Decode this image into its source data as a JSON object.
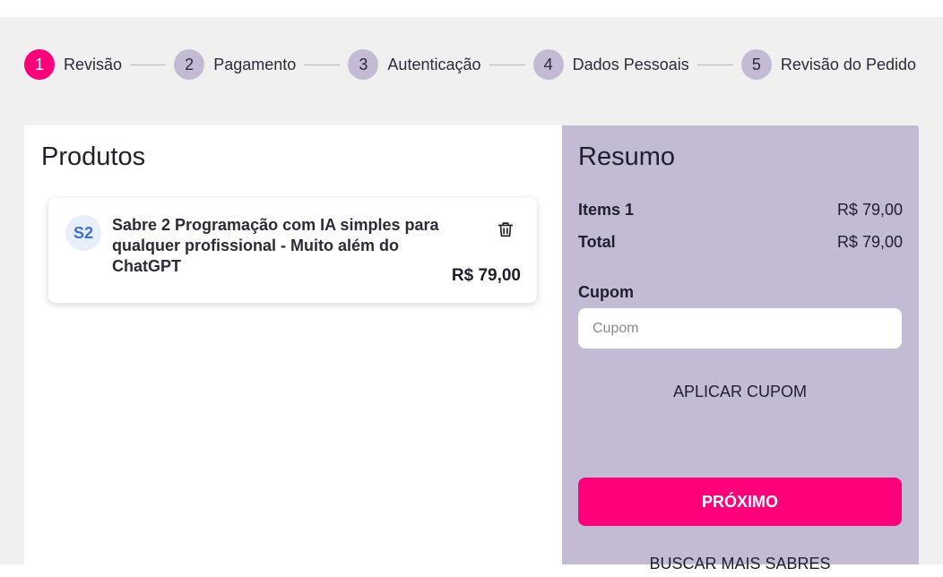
{
  "stepper": {
    "steps": [
      {
        "number": "1",
        "label": "Revisão",
        "active": true
      },
      {
        "number": "2",
        "label": "Pagamento",
        "active": false
      },
      {
        "number": "3",
        "label": "Autenticação",
        "active": false
      },
      {
        "number": "4",
        "label": "Dados Pessoais",
        "active": false
      },
      {
        "number": "5",
        "label": "Revisão do Pedido",
        "active": false
      }
    ]
  },
  "products": {
    "title": "Produtos",
    "items": [
      {
        "avatar": "S2",
        "name": "Sabre 2 Programação com IA simples para qualquer profissional - Muito além do ChatGPT",
        "price": "R$ 79,00",
        "delete_icon": "trash-icon"
      }
    ]
  },
  "summary": {
    "title": "Resumo",
    "items_label": "Items 1",
    "items_value": "R$ 79,00",
    "total_label": "Total",
    "total_value": "R$ 79,00",
    "coupon_label": "Cupom",
    "coupon_placeholder": "Cupom",
    "coupon_value": "",
    "apply_label": "APLICAR CUPOM",
    "next_label": "PRÓXIMO",
    "more_label": "BUSCAR MAIS SABRES"
  },
  "colors": {
    "accent": "#ff007a",
    "summary_bg": "#c2bbd3",
    "page_bg": "#f0f0f0"
  }
}
